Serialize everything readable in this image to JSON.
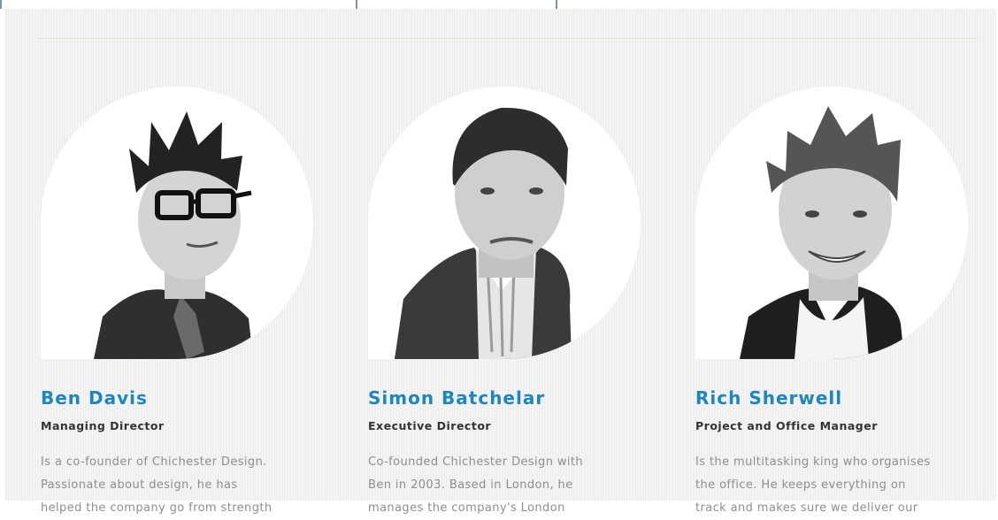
{
  "team": {
    "members": [
      {
        "name": "Ben Davis",
        "role": "Managing Director",
        "bio_lines": [
          "Is a co-founder of Chichester Design.",
          "Passionate about design, he has",
          "helped the company go from strength"
        ]
      },
      {
        "name": "Simon Batchelar",
        "role": "Executive Director",
        "bio_lines": [
          "Co-founded Chichester Design with",
          "Ben in 2003. Based in London, he",
          "manages the company's London"
        ]
      },
      {
        "name": "Rich Sherwell",
        "role": "Project and Office Manager",
        "bio_lines": [
          "Is the multitasking king who organises",
          "the office. He keeps everything on",
          "track and makes sure we deliver our"
        ]
      }
    ]
  },
  "colors": {
    "name_blue": "#1e86bf",
    "role_dark": "#333333",
    "bio_grey": "#8e8e8e",
    "panel_bg": "#f3f3f1"
  }
}
